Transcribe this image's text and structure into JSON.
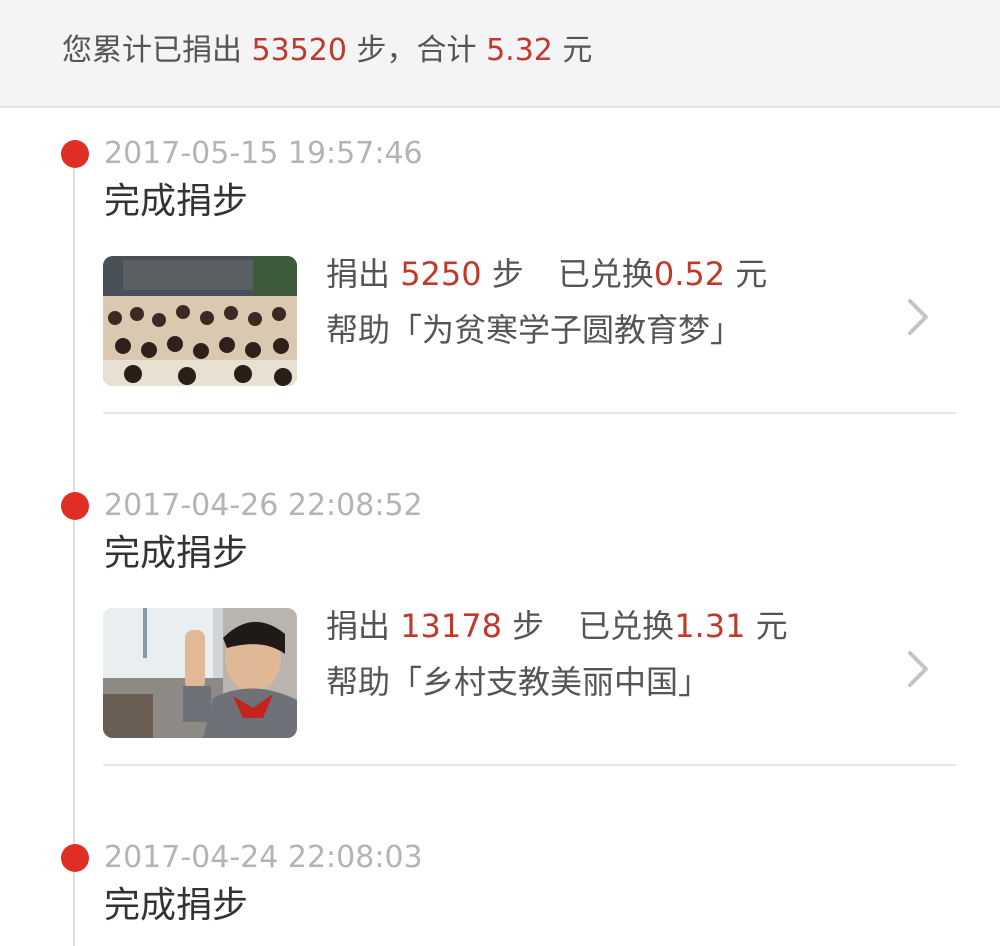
{
  "summary": {
    "prefix": "您累计已捐出",
    "total_steps": "53520",
    "steps_unit": "步，合计",
    "total_amount": "5.32",
    "amount_unit": "元"
  },
  "records": [
    {
      "time": "2017-05-15 19:57:46",
      "action": "完成捐步",
      "steps_label": "捐出",
      "steps": "5250",
      "steps_unit": "步",
      "exchanged_label": "已兑换",
      "amount": "0.52",
      "amount_unit": "元",
      "help_label": "帮助「为贫寒学子圆教育梦」"
    },
    {
      "time": "2017-04-26 22:08:52",
      "action": "完成捐步",
      "steps_label": "捐出",
      "steps": "13178",
      "steps_unit": "步",
      "exchanged_label": "已兑换",
      "amount": "1.31",
      "amount_unit": "元",
      "help_label": "帮助「乡村支教美丽中国」"
    },
    {
      "time": "2017-04-24 22:08:03",
      "action": "完成捐步"
    }
  ],
  "colors": {
    "accent": "#e02e24",
    "highlight_text": "#c0392b",
    "muted_text": "#b4b4b4",
    "summary_bg": "#f4f3f5"
  },
  "icons": {
    "timeline_dot": "timeline-dot-icon",
    "chevron": "chevron-right-icon"
  }
}
